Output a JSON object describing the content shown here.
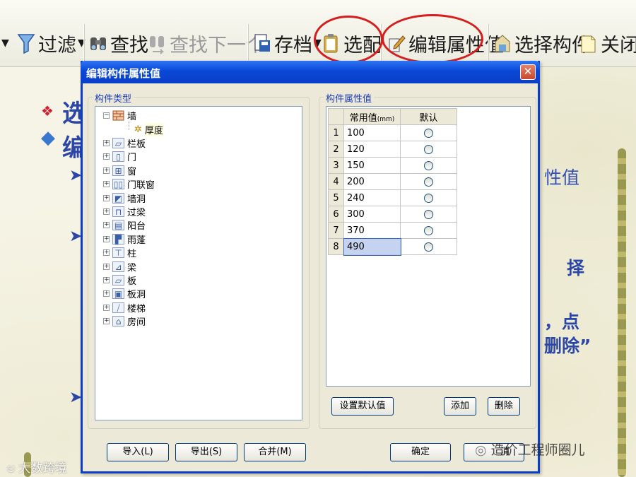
{
  "toolbar": {
    "filter_label": "过滤",
    "find_label": "查找",
    "find_next_label": "查找下一个",
    "save_label": "存档",
    "match_label": "选配",
    "edit_props_label": "编辑属性值",
    "select_component_label": "选择构件",
    "close_label": "关闭"
  },
  "slide": {
    "line1": "选",
    "line2": "编",
    "right1": "性值",
    "right2": "择",
    "right3": "，点",
    "right4": "删除”"
  },
  "dialog": {
    "title": "编辑构件属性值",
    "close_glyph": "✕",
    "left_group_label": "构件类型",
    "right_group_label": "构件属性值",
    "tree": {
      "root": "墙",
      "child": "厚度",
      "items": [
        "栏板",
        "门",
        "窗",
        "门联窗",
        "墙洞",
        "过梁",
        "阳台",
        "雨蓬",
        "柱",
        "梁",
        "板",
        "板洞",
        "楼梯",
        "房间"
      ]
    },
    "grid": {
      "col_value": "常用值",
      "col_value_unit": "(mm)",
      "col_default": "默认",
      "rows": [
        {
          "num": "1",
          "value": "100"
        },
        {
          "num": "2",
          "value": "120"
        },
        {
          "num": "3",
          "value": "150"
        },
        {
          "num": "4",
          "value": "200"
        },
        {
          "num": "5",
          "value": "240"
        },
        {
          "num": "6",
          "value": "300"
        },
        {
          "num": "7",
          "value": "370"
        },
        {
          "num": "8",
          "value": "490"
        }
      ]
    },
    "buttons": {
      "set_default": "设置默认值",
      "add": "添加",
      "delete": "删除",
      "import": "导入(L)",
      "export": "导出(S)",
      "merge": "合并(M)",
      "ok": "确定",
      "cancel_partial": "消"
    }
  },
  "watermarks": {
    "left": "大数跨境",
    "right": "造价工程师圈儿"
  },
  "colors": {
    "highlight_red": "#d51e1e",
    "title_blue": "#0a48d8",
    "slide_text_blue": "#2b46a8"
  }
}
